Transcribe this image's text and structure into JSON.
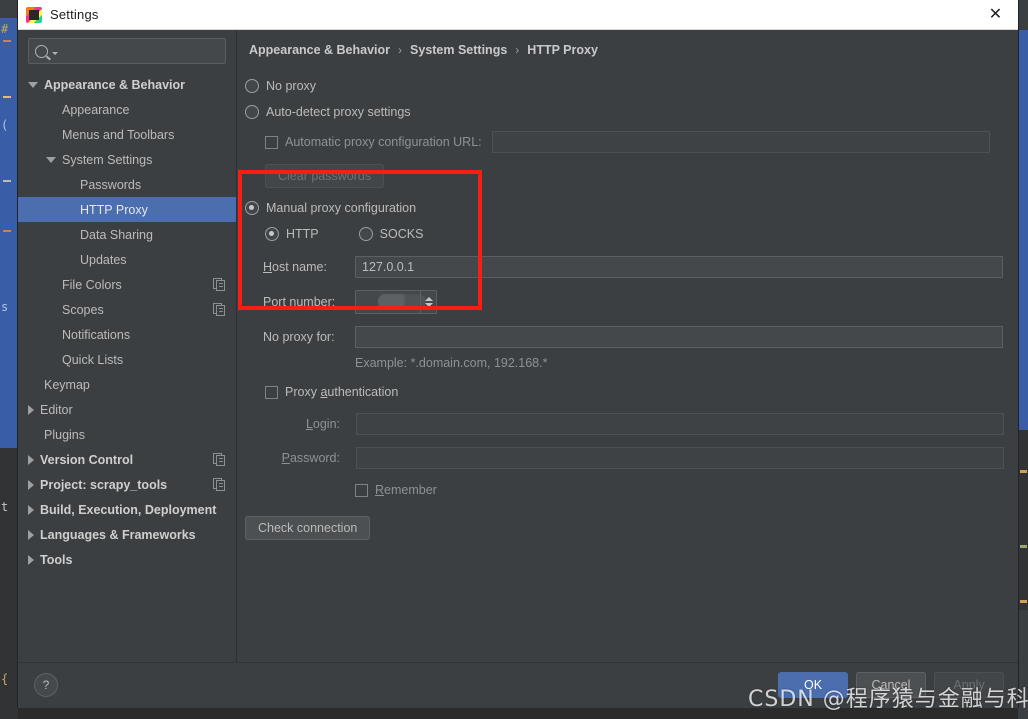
{
  "window": {
    "title": "Settings",
    "app_icon": "intellij-logo-icon",
    "close_label": "✕"
  },
  "search": {
    "value": "",
    "placeholder": "",
    "icon": "search-icon"
  },
  "sidebar": {
    "items": [
      {
        "label": "Appearance & Behavior",
        "indent": 0,
        "arrow": "down",
        "bold": true,
        "selected": false,
        "copy_icon": false
      },
      {
        "label": "Appearance",
        "indent": 1,
        "arrow": "none",
        "bold": false,
        "selected": false,
        "copy_icon": false
      },
      {
        "label": "Menus and Toolbars",
        "indent": 1,
        "arrow": "none",
        "bold": false,
        "selected": false,
        "copy_icon": false
      },
      {
        "label": "System Settings",
        "indent": 1,
        "arrow": "down",
        "bold": false,
        "selected": false,
        "copy_icon": false
      },
      {
        "label": "Passwords",
        "indent": 2,
        "arrow": "none",
        "bold": false,
        "selected": false,
        "copy_icon": false
      },
      {
        "label": "HTTP Proxy",
        "indent": 2,
        "arrow": "none",
        "bold": false,
        "selected": true,
        "copy_icon": false
      },
      {
        "label": "Data Sharing",
        "indent": 2,
        "arrow": "none",
        "bold": false,
        "selected": false,
        "copy_icon": false
      },
      {
        "label": "Updates",
        "indent": 2,
        "arrow": "none",
        "bold": false,
        "selected": false,
        "copy_icon": false
      },
      {
        "label": "File Colors",
        "indent": 1,
        "arrow": "none",
        "bold": false,
        "selected": false,
        "copy_icon": true
      },
      {
        "label": "Scopes",
        "indent": 1,
        "arrow": "none",
        "bold": false,
        "selected": false,
        "copy_icon": true
      },
      {
        "label": "Notifications",
        "indent": 1,
        "arrow": "none",
        "bold": false,
        "selected": false,
        "copy_icon": false
      },
      {
        "label": "Quick Lists",
        "indent": 1,
        "arrow": "none",
        "bold": false,
        "selected": false,
        "copy_icon": false
      },
      {
        "label": "Keymap",
        "indent": 0,
        "arrow": "none",
        "bold": false,
        "selected": false,
        "copy_icon": false
      },
      {
        "label": "Editor",
        "indent": 0,
        "arrow": "right",
        "bold": false,
        "selected": false,
        "copy_icon": false
      },
      {
        "label": "Plugins",
        "indent": 0,
        "arrow": "none",
        "bold": false,
        "selected": false,
        "copy_icon": false
      },
      {
        "label": "Version Control",
        "indent": 0,
        "arrow": "right",
        "bold": true,
        "selected": false,
        "copy_icon": true
      },
      {
        "label": "Project: scrapy_tools",
        "indent": 0,
        "arrow": "right",
        "bold": true,
        "selected": false,
        "copy_icon": true
      },
      {
        "label": "Build, Execution, Deployment",
        "indent": 0,
        "arrow": "right",
        "bold": true,
        "selected": false,
        "copy_icon": false
      },
      {
        "label": "Languages & Frameworks",
        "indent": 0,
        "arrow": "right",
        "bold": true,
        "selected": false,
        "copy_icon": false
      },
      {
        "label": "Tools",
        "indent": 0,
        "arrow": "right",
        "bold": true,
        "selected": false,
        "copy_icon": false
      }
    ]
  },
  "breadcrumb": {
    "part1": "Appearance & Behavior",
    "sep1": "›",
    "part2": "System Settings",
    "sep2": "›",
    "part3": "HTTP Proxy"
  },
  "proxy_form": {
    "no_proxy_label": "No proxy",
    "no_proxy_selected": false,
    "auto_detect_label": "Auto-detect proxy settings",
    "auto_detect_selected": false,
    "auto_config_url_label": "Automatic proxy configuration URL:",
    "auto_config_url_checked": false,
    "auto_config_url_value": "",
    "clear_passwords_label": "Clear passwords",
    "manual_label": "Manual proxy configuration",
    "manual_selected": true,
    "http_label": "HTTP",
    "http_selected": true,
    "socks_label": "SOCKS",
    "socks_selected": false,
    "host_name_label_pre": "H",
    "host_name_label_post": "ost name:",
    "host_name_value": "127.0.0.1",
    "port_number_label_pre": "Port ",
    "port_number_label_u": "n",
    "port_number_label_post": "umber:",
    "port_number_value": "",
    "no_proxy_for_label": "No proxy for:",
    "no_proxy_for_value": "",
    "example_text": "Example: *.domain.com, 192.168.*",
    "proxy_auth_label_pre": "Proxy ",
    "proxy_auth_label_u": "a",
    "proxy_auth_label_post": "uthentication",
    "proxy_auth_checked": false,
    "login_label_pre": "L",
    "login_label_post": "ogin:",
    "login_value": "",
    "password_label_pre": "P",
    "password_label_post": "assword:",
    "password_value": "",
    "remember_label_pre": "R",
    "remember_label_post": "emember",
    "remember_checked": false,
    "check_connection_label": "Check connection"
  },
  "footer": {
    "help_label": "?",
    "ok_label": "OK",
    "cancel_label": "Cancel",
    "apply_label": "Apply"
  },
  "annotation": {
    "highlight_color": "#fa1e12"
  },
  "watermark": {
    "text": "CSDN @程序猿与金融与科技"
  }
}
